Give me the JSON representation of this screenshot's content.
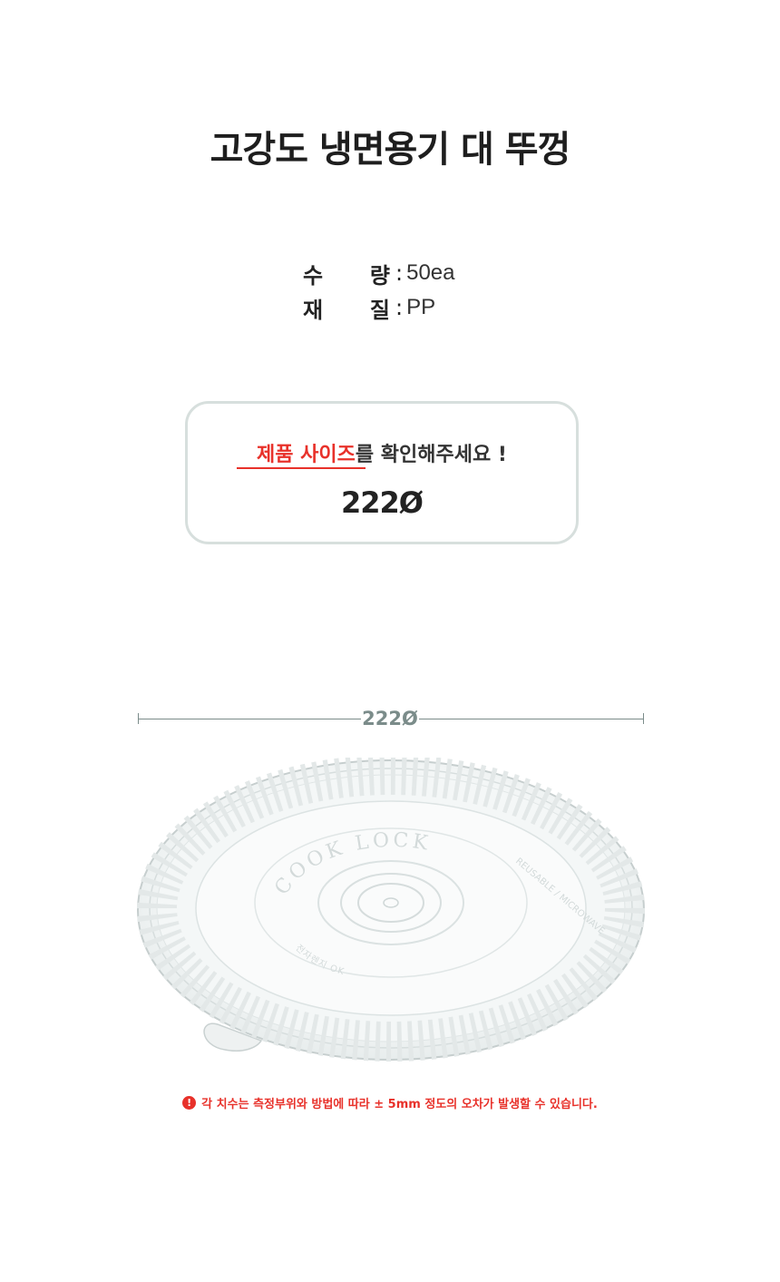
{
  "title": "고강도 냉면용기 대 뚜껑",
  "specs": [
    {
      "label_a": "수",
      "label_b": "량",
      "sep": ":",
      "value": "50ea"
    },
    {
      "label_a": "재",
      "label_b": "질",
      "sep": ":",
      "value": "PP"
    }
  ],
  "size_box": {
    "notice_highlight": "제품 사이즈",
    "notice_rest": "를 확인해주세요 !",
    "size": "222Ø"
  },
  "dimension": {
    "label": "222Ø"
  },
  "lid": {
    "emboss_brand": "COOK LOCK",
    "emboss_text_1": "REUSABLE / MICROWAVE",
    "emboss_text_2": "전자렌지 OK"
  },
  "disclaimer": {
    "icon": "!",
    "text": "각 치수는 측정부위와 방법에 따라 ± 5mm 정도의 오차가 발생할 수 있습니다."
  },
  "colors": {
    "accent": "#e8312a",
    "dimension": "#7b8c8a",
    "border": "#d7dfdd"
  }
}
